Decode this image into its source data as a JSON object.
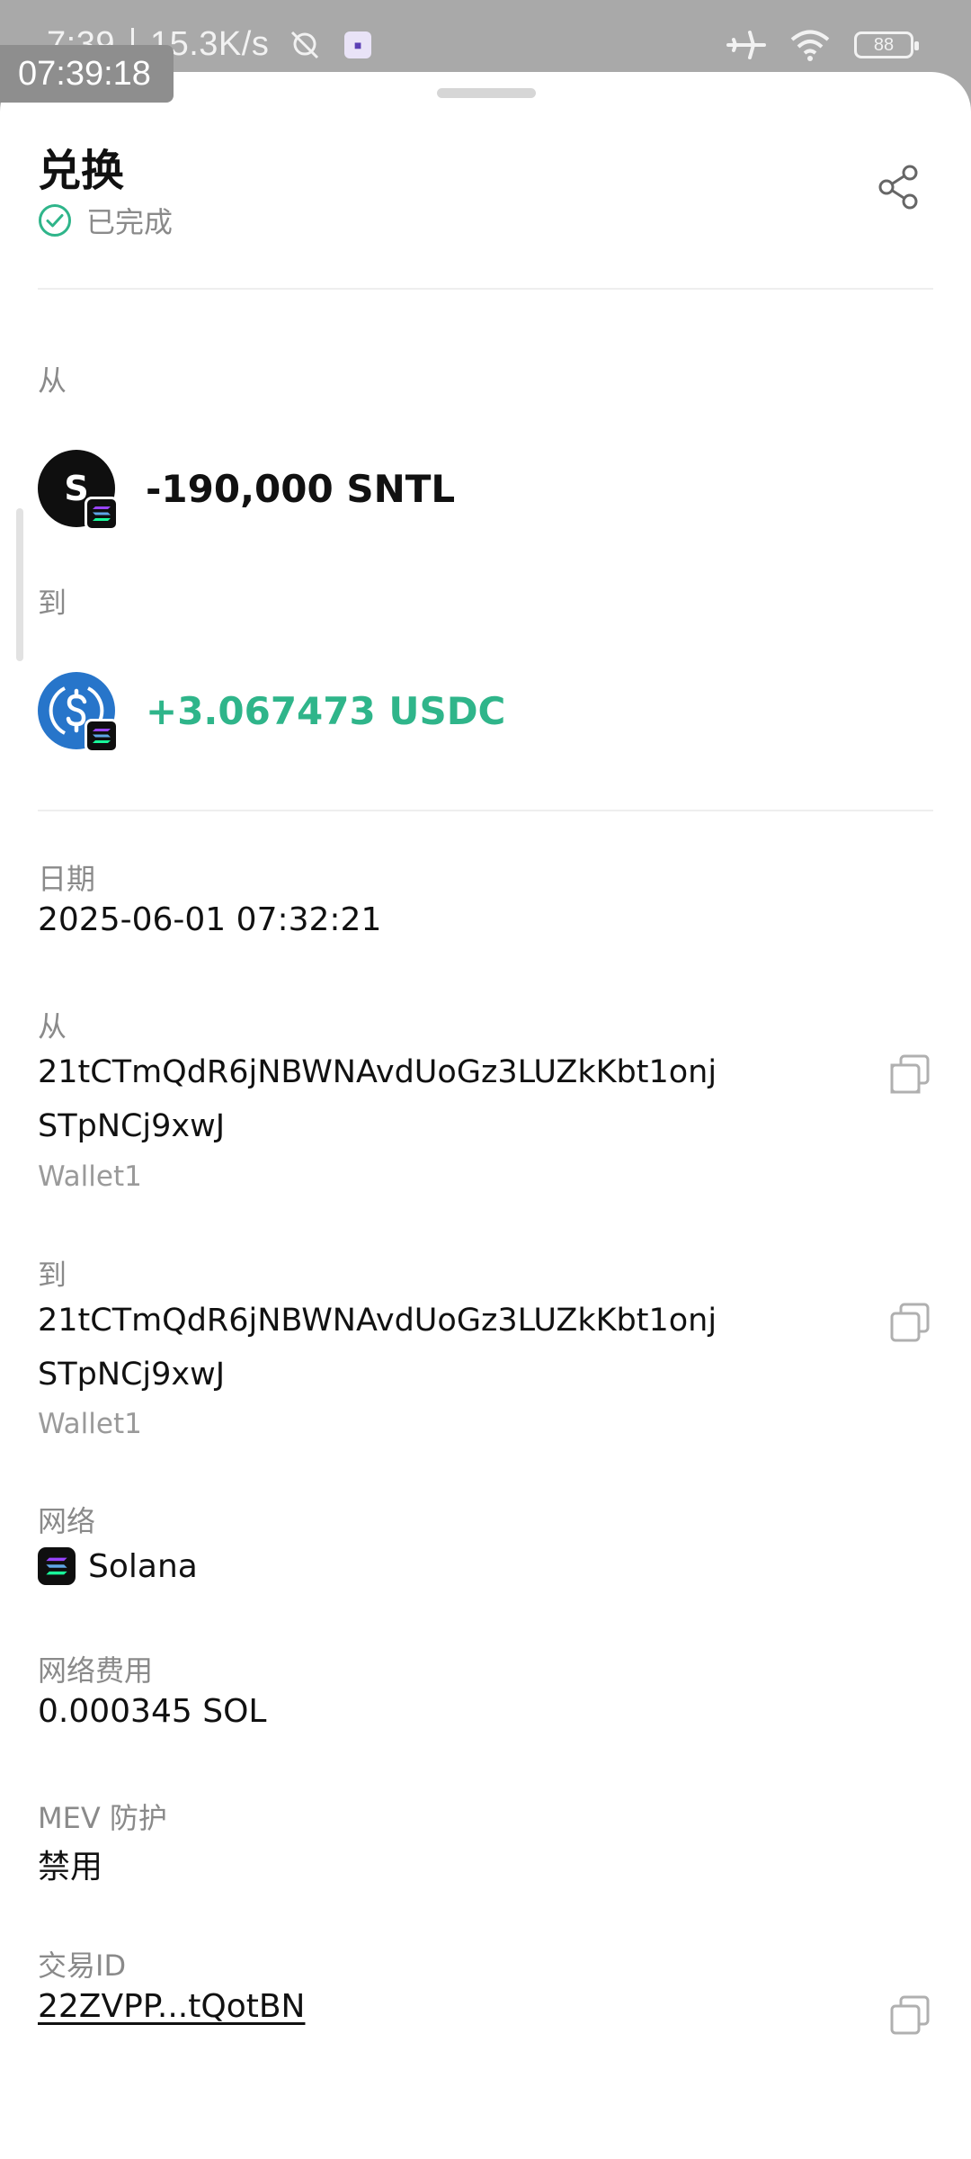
{
  "status_bar": {
    "time": "7:39",
    "net_speed": "15.3K/s",
    "battery": "88",
    "overlay_clock": "07:39:18"
  },
  "header": {
    "title": "兑换",
    "status": "已完成"
  },
  "swap": {
    "from_label": "从",
    "from_token_letter": "S",
    "from_amount": "-190,000 SNTL",
    "to_label": "到",
    "to_amount": "+3.067473 USDC"
  },
  "details": {
    "date_label": "日期",
    "date_value": "2025-06-01 07:32:21",
    "from_label": "从",
    "from_address": "21tCTmQdR6jNBWNAvdUoGz3LUZkKbt1onjSTpNCj9xwJ",
    "from_wallet": "Wallet1",
    "to_label": "到",
    "to_address": "21tCTmQdR6jNBWNAvdUoGz3LUZkKbt1onjSTpNCj9xwJ",
    "to_wallet": "Wallet1",
    "network_label": "网络",
    "network_value": "Solana",
    "fee_label": "网络费用",
    "fee_value": "0.000345 SOL",
    "mev_label": "MEV 防护",
    "mev_value": "禁用",
    "txid_label": "交易ID",
    "txid_value": "22ZVPP...tQotBN"
  },
  "colors": {
    "positive": "#2fb58a",
    "usdc_blue": "#2775ca"
  }
}
